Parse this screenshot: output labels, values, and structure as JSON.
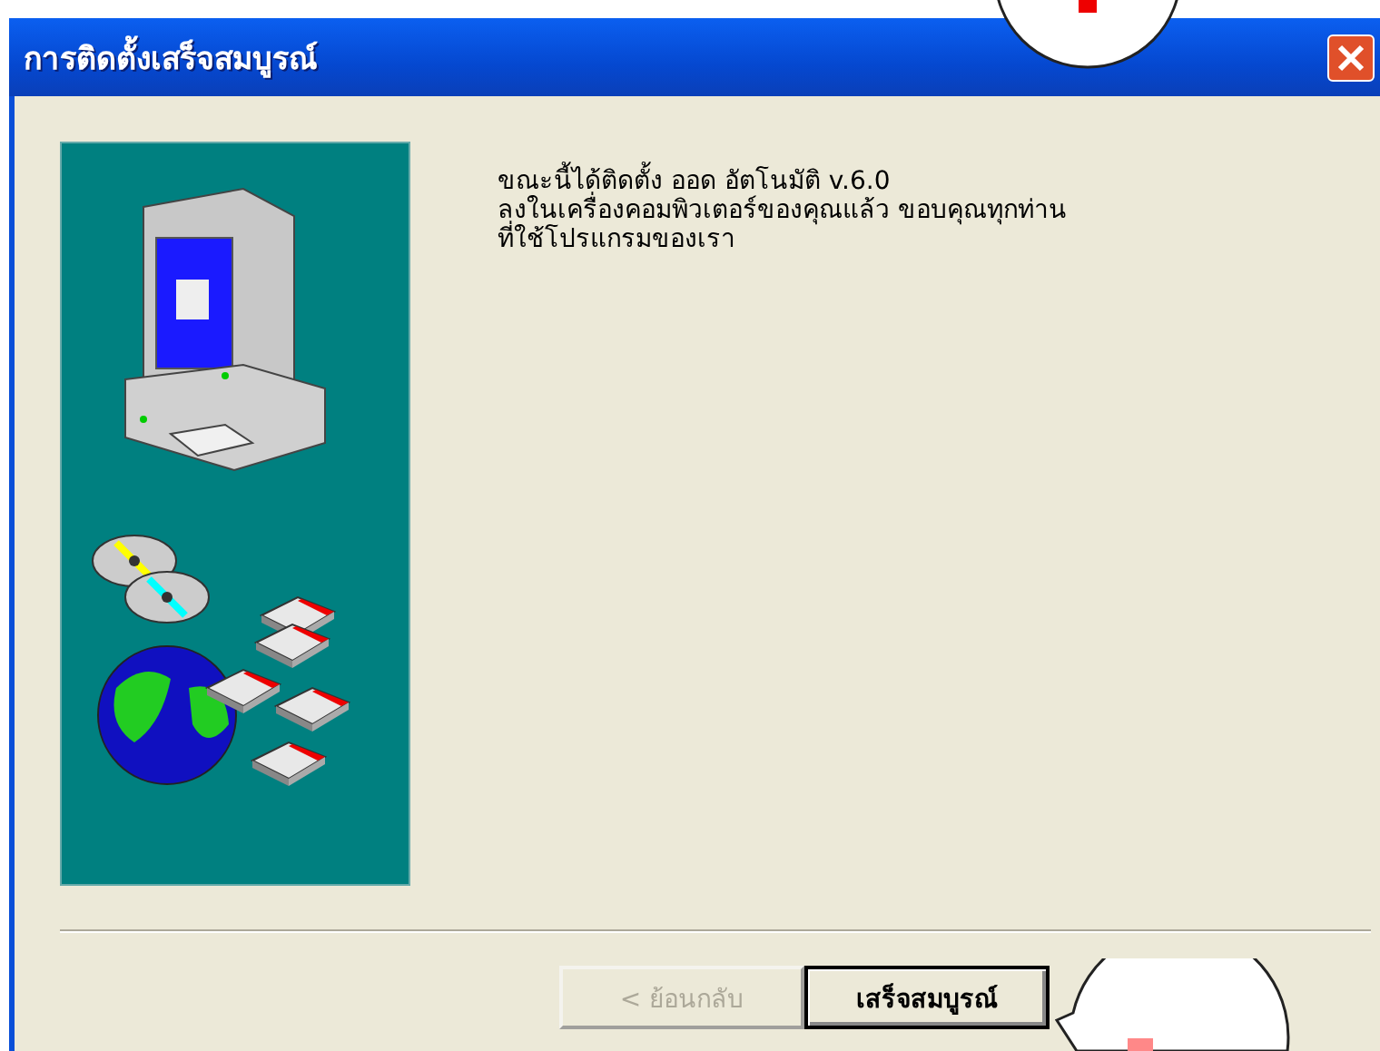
{
  "window": {
    "title": "การติดตั้งเสร็จสมบูรณ์"
  },
  "message": "ขณะนี้ได้ติดตั้ง ออด อัตโนมัติ v.6.0\nลงในเครื่องคอมพิวเตอร์ของคุณแล้ว ขอบคุณทุกท่าน\nที่ใช้โปรแกรมของเรา",
  "buttons": [
    {
      "label": "< ย้อนกลับ",
      "disabled": true,
      "default": false
    },
    {
      "label": "เสร็จสมบูรณ์",
      "disabled": false,
      "default": true
    }
  ]
}
